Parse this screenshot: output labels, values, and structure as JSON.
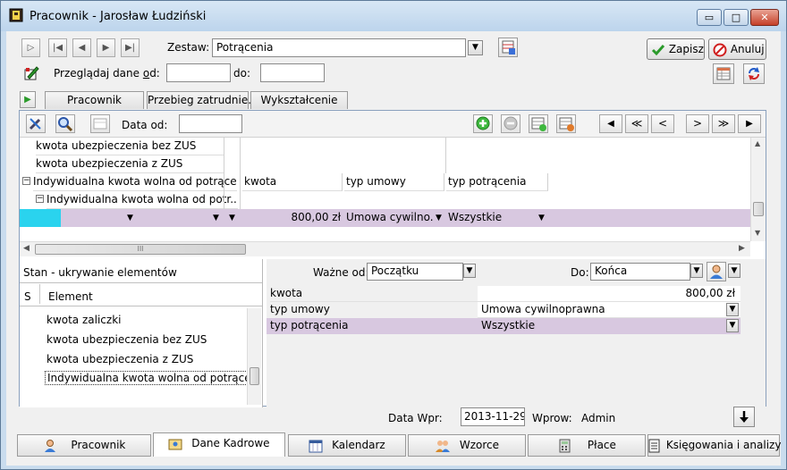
{
  "window": {
    "title": "Pracownik - Jarosław Łudziński",
    "controls": {
      "minimize": "▭",
      "maximize": "□",
      "close": "✕"
    }
  },
  "toolbar": {
    "zestaw_label": "Zestaw:",
    "zestaw_value": "Potrącenia",
    "save_label": "Zapisz",
    "cancel_label": "Anuluj",
    "browse_label_before": "Przeglądaj dane ",
    "browse_label_underlined": "o",
    "browse_label_after": "d:",
    "browse_from_value": "",
    "browse_to_label": "do:",
    "browse_to_value": ""
  },
  "tabs": [
    "Pracownik",
    "Przebieg zatrudnie...",
    "Wykształcenie"
  ],
  "panel": {
    "data_od_label": "Data od:",
    "data_od_value": "",
    "nav": [
      "◀",
      "≪",
      "<",
      ">",
      "≫",
      "▶"
    ]
  },
  "grid": {
    "tree_rows": [
      "kwota ubezpieczenia bez ZUS",
      "kwota ubezpieczenia z ZUS",
      "Indywidualna kwota wolna od potrąceń",
      "Indywidualna kwota wolna od potr..."
    ],
    "columns": [
      "kwota",
      "typ umowy",
      "typ potrącenia"
    ],
    "selected_row": {
      "kwota": "800,00 zł",
      "typ_umowy": "Umowa cywilno...",
      "typ_potracenia": "Wszystkie"
    }
  },
  "state_list": {
    "title": "Stan - ukrywanie elementów",
    "col_s": "S",
    "col_element": "Element",
    "items": [
      "kwota zaliczki",
      "kwota ubezpieczenia bez ZUS",
      "kwota ubezpieczenia z ZUS",
      "Indywidualna kwota wolna od potrąceń"
    ]
  },
  "detail": {
    "wazne_od_label": "Ważne od:",
    "wazne_od_value": "Początku",
    "do_label": "Do:",
    "do_value": "Końca",
    "rows": [
      {
        "name": "kwota",
        "value": "800,00 zł"
      },
      {
        "name": "typ umowy",
        "value": "Umowa cywilnoprawna"
      },
      {
        "name": "typ potrącenia",
        "value": "Wszystkie"
      }
    ]
  },
  "footer": {
    "data_wpr_label": "Data Wpr:",
    "data_wpr_value": "2013-11-29",
    "wprow_label": "Wprow:",
    "wprow_value": "Admin"
  },
  "bottom_tabs": [
    "Pracownik",
    "Dane Kadrowe",
    "Kalendarz",
    "Wzorce",
    "Płace",
    "Księgowania i analizy"
  ],
  "colors": {
    "selected_row": "#d8c8e0",
    "cursor_cell": "#2ad3ee",
    "accent_green": "#2a9a2a"
  }
}
